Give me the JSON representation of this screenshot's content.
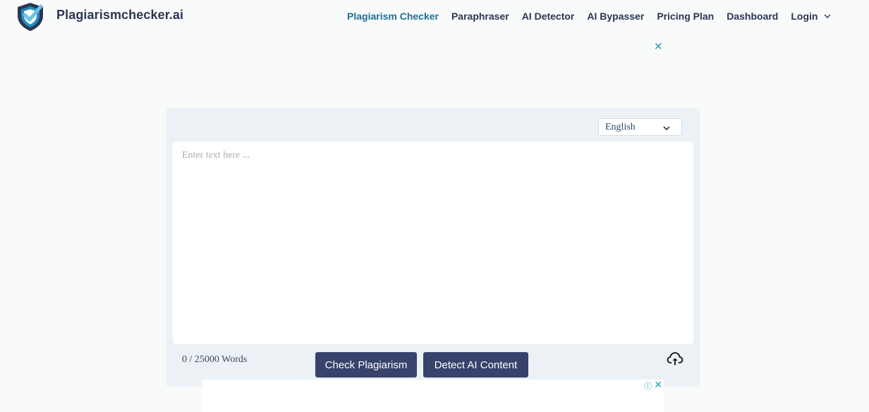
{
  "header": {
    "brand": "Plagiarismchecker.ai",
    "nav": [
      {
        "label": "Plagiarism Checker",
        "active": true
      },
      {
        "label": "Paraphraser"
      },
      {
        "label": "AI Detector"
      },
      {
        "label": "AI Bypasser"
      },
      {
        "label": "Pricing Plan"
      },
      {
        "label": "Dashboard"
      },
      {
        "label": "Login",
        "has_dropdown": true
      }
    ]
  },
  "ads": {
    "top_close": "✕",
    "bottom_info": "ⓘ",
    "bottom_close": "✕"
  },
  "checker": {
    "language": "English",
    "placeholder": "Enter text here ...",
    "text": "",
    "word_count": "0 / 25000 Words",
    "check_button": "Check Plagiarism",
    "detect_button": "Detect AI Content"
  },
  "colors": {
    "accent": "#1f6f95",
    "button": "#38426a",
    "panel": "#ecf1f6",
    "nav_text": "#2c3553",
    "ad_icon": "#1aa1b8"
  },
  "icons": {
    "logo": "shield-check-icon",
    "dropdown": "chevron-down-icon",
    "upload": "cloud-upload-icon",
    "close": "close-icon",
    "info": "info-icon"
  }
}
